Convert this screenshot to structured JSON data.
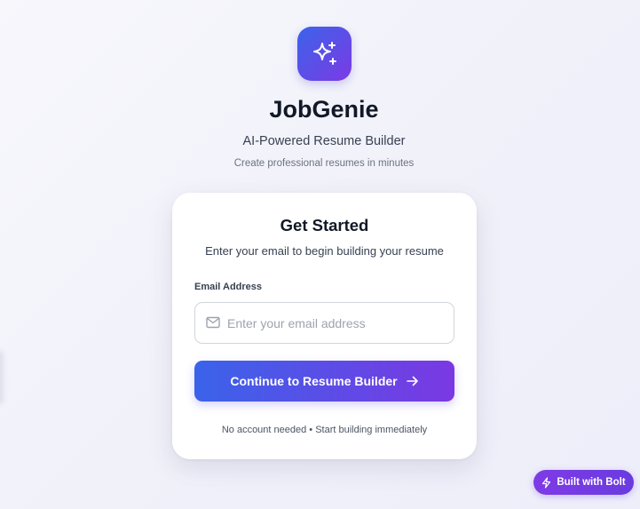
{
  "brand": {
    "title": "JobGenie",
    "subtitle": "AI-Powered Resume Builder",
    "tagline": "Create professional resumes in minutes",
    "logo_icon": "sparkles-icon"
  },
  "card": {
    "title": "Get Started",
    "description": "Enter your email to begin building your resume",
    "email": {
      "label": "Email Address",
      "placeholder": "Enter your email address",
      "value": "",
      "icon": "mail-icon"
    },
    "continue_button": {
      "label": "Continue to Resume Builder",
      "icon": "arrow-right-icon"
    },
    "footnote": "No account needed • Start building immediately"
  },
  "badge": {
    "label": "Built with Bolt",
    "icon": "bolt-icon"
  },
  "colors": {
    "accent_start": "#3a63ea",
    "accent_end": "#7b38e3",
    "badge": "#7e3be6"
  }
}
